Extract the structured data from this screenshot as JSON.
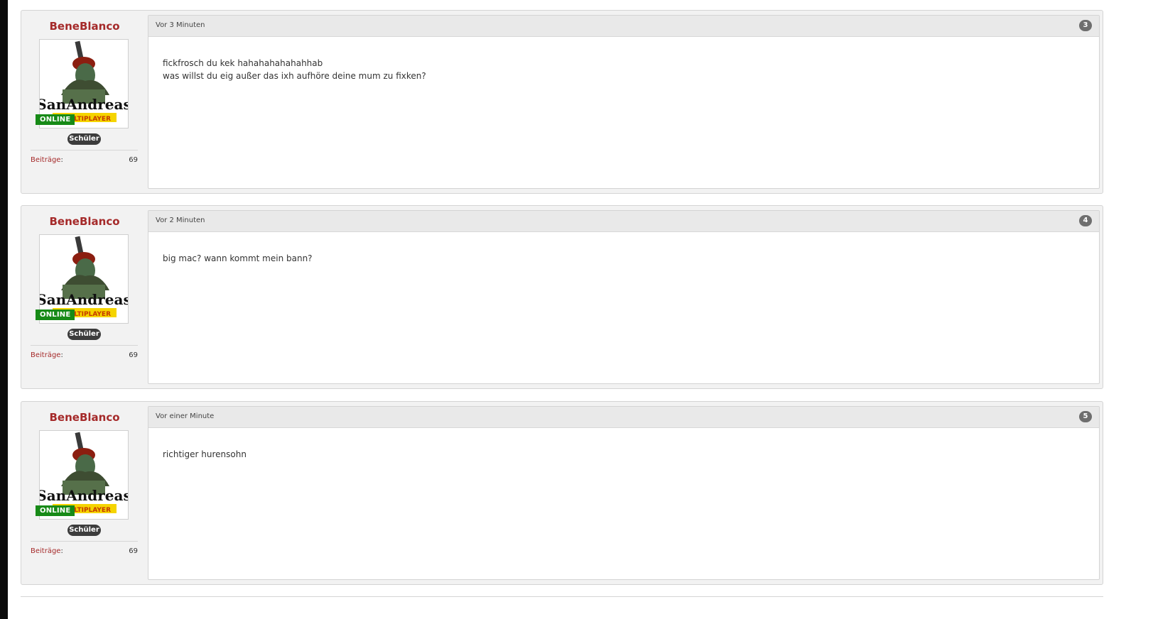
{
  "posts": [
    {
      "username": "BeneBlanco",
      "online_label": "ONLINE",
      "rank": "Schüler",
      "stat_label": "Beiträge",
      "stat_value": "69",
      "timestamp": "Vor 3 Minuten",
      "post_number": "3",
      "message_lines": [
        "fickfrosch du kek hahahahahahahhab",
        "was willst du eig außer das ixh aufhöre deine mum zu fixken?"
      ]
    },
    {
      "username": "BeneBlanco",
      "online_label": "ONLINE",
      "rank": "Schüler",
      "stat_label": "Beiträge",
      "stat_value": "69",
      "timestamp": "Vor 2 Minuten",
      "post_number": "4",
      "message_lines": [
        "big mac? wann kommt mein bann?"
      ]
    },
    {
      "username": "BeneBlanco",
      "online_label": "ONLINE",
      "rank": "Schüler",
      "stat_label": "Beiträge",
      "stat_value": "69",
      "timestamp": "Vor einer Minute",
      "post_number": "5",
      "message_lines": [
        "richtiger hurensohn"
      ]
    }
  ],
  "avatar": {
    "logo_text_line1": "SanAndreas",
    "logo_text_line2": "MULTIPLAYER"
  },
  "colors": {
    "username": "#a52a2a",
    "online_badge": "#178a17",
    "rank_badge": "#3c3c3c",
    "post_number_badge": "#6e6e6e"
  }
}
